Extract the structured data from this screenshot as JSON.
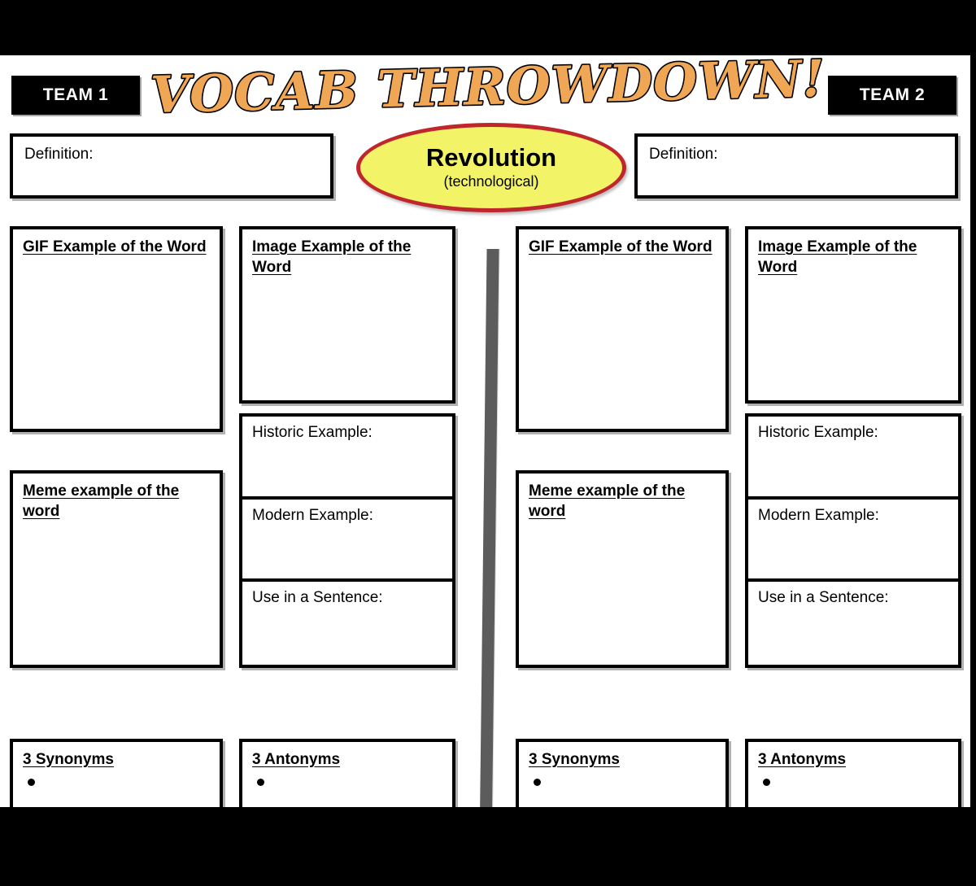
{
  "title": "VOCAB THROWDOWN!",
  "vocab": {
    "word": "Revolution",
    "qualifier": "(technological)"
  },
  "colors": {
    "title_fill": "#f0a755",
    "title_outline": "#000000",
    "oval_fill": "#f3f368",
    "oval_border": "#c0272d",
    "divider": "#5c5c5c",
    "frame": "#000000"
  },
  "teams": [
    {
      "badge": "TEAM 1",
      "definition_label": "Definition:",
      "gif_label": "GIF Example of the Word",
      "meme_label": "Meme example of the word",
      "image_label": "Image Example of the Word",
      "historic_label": "Historic Example:",
      "modern_label": "Modern Example:",
      "sentence_label": "Use in a Sentence:",
      "synonyms_label": "3 Synonyms",
      "antonyms_label": "3 Antonyms",
      "synonyms_items": [
        ""
      ],
      "antonyms_items": [
        ""
      ]
    },
    {
      "badge": "TEAM 2",
      "definition_label": "Definition:",
      "gif_label": "GIF Example of the Word",
      "meme_label": "Meme example of the word",
      "image_label": "Image Example of the Word",
      "historic_label": "Historic Example:",
      "modern_label": "Modern Example:",
      "sentence_label": "Use in a Sentence:",
      "synonyms_label": "3 Synonyms",
      "antonyms_label": "3 Antonyms",
      "synonyms_items": [
        ""
      ],
      "antonyms_items": [
        ""
      ]
    }
  ]
}
